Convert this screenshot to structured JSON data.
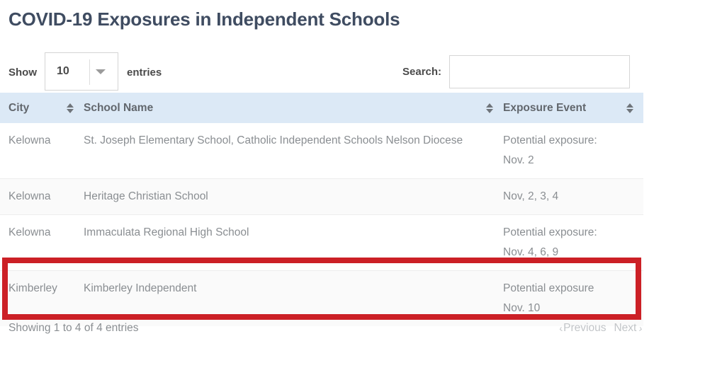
{
  "page": {
    "title": "COVID-19 Exposures in Independent Schools"
  },
  "controls": {
    "length": {
      "label_prefix": "Show",
      "selected": "10",
      "label_suffix": "entries",
      "caret_icon": "chevron-down-icon"
    },
    "search": {
      "label": "Search:",
      "value": "",
      "placeholder": ""
    }
  },
  "table": {
    "columns": [
      {
        "label": "City",
        "sortable": false
      },
      {
        "label": "School Name",
        "sortable": true
      },
      {
        "label": "Exposure Event",
        "sortable": true
      }
    ],
    "sort_icon": "sort-updown-icon",
    "rows": [
      {
        "city": "Kelowna",
        "school": "St. Joseph Elementary School, Catholic Independent Schools Nelson Diocese",
        "event": "Potential exposure:\nNov. 2",
        "highlighted": false
      },
      {
        "city": "Kelowna",
        "school": "Heritage Christian School",
        "event": "Nov, 2, 3, 4",
        "highlighted": false
      },
      {
        "city": "Kelowna",
        "school": "Immaculata Regional High School",
        "event": "Potential exposure:\nNov. 4, 6, 9",
        "highlighted": false
      },
      {
        "city": "Kimberley",
        "school": "Kimberley Independent",
        "event": "Potential exposure\nNov. 10",
        "highlighted": true
      }
    ]
  },
  "footer": {
    "showing": "Showing 1 to 4 of 4 entries",
    "previous": "Previous",
    "next": "Next",
    "previous_icon": "chevron-left-icon",
    "next_icon": "chevron-right-icon"
  },
  "colors": {
    "title": "#3f4c61",
    "header_bg": "#dce9f6",
    "highlight_border": "#cc2026",
    "body_text": "#8a8e92"
  }
}
